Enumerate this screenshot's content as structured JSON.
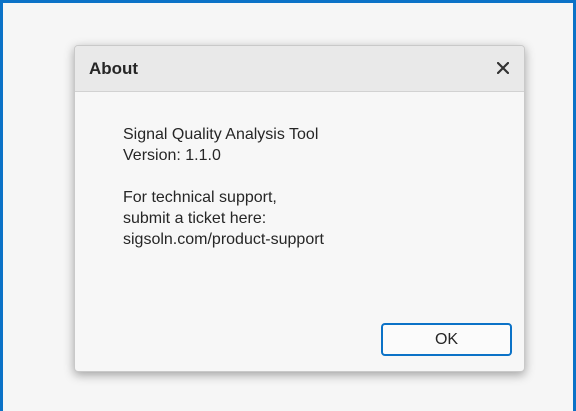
{
  "dialog": {
    "title": "About",
    "close_icon": "close-icon",
    "app_name": "Signal Quality Analysis Tool",
    "version_line": "Version: 1.1.0",
    "support_line1": "For technical support,",
    "support_line2": "submit a ticket here:",
    "support_url": "sigsoln.com/product-support",
    "ok_label": "OK"
  },
  "colors": {
    "accent": "#0b72c7",
    "dialog_background": "#f7f7f7",
    "header_background": "#e9e9e9",
    "text": "#262626"
  }
}
